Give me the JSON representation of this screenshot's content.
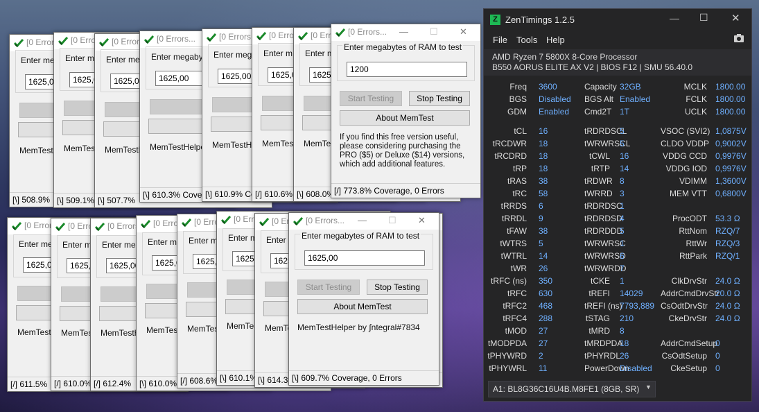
{
  "memtest": {
    "title": "[0 Errors...",
    "prompt": "Enter megabytes of RAM to test",
    "start_label": "Start Testing",
    "stop_label": "Stop Testing",
    "about_label": "About MemTest",
    "status_prefix": "[\\]",
    "win_top": [
      {
        "title": "[0 Errors",
        "prompt": "Enter meg",
        "value": "1625,00",
        "start": "Start Te",
        "about": "",
        "foot": "MemTestH",
        "status": "[\\]  508.9%"
      },
      {
        "title": "[0 Errors",
        "prompt": "Enter me",
        "value": "1625,00",
        "start": "Start Te",
        "about": "",
        "foot": "MemTestH",
        "status": "[\\]  509.1%"
      },
      {
        "title": "[0 Errors",
        "prompt": "Enter me",
        "value": "1625,00",
        "start": "Start Te",
        "about": "",
        "foot": "MemTestH",
        "status": "[\\]  507.7%"
      },
      {
        "title": "[0 Errors...",
        "prompt": "Enter megabytes",
        "value": "1625,00",
        "start": "Start Testing",
        "about": "Abou",
        "foot": "MemTestHelper",
        "status": "[\\]  610.3% Cover"
      },
      {
        "title": "[0 Errors...",
        "prompt": "Enter mega",
        "value": "1625,00",
        "start": "Start Test",
        "about": "A",
        "foot": "MemTestHelp",
        "status": "[\\]  610.9% Cove"
      },
      {
        "title": "[0 Errors",
        "prompt": "Enter m",
        "value": "1625,00",
        "start": "Start T",
        "about": "",
        "foot": "MemTes",
        "status": "[/]  610.6%"
      },
      {
        "title": "[0 Errors",
        "prompt": "Enter m",
        "value": "1625,00",
        "start": "Start T",
        "about": "",
        "foot": "MemTes",
        "status": "[\\]  608.0%"
      }
    ],
    "main_top": {
      "title": "[0 Errors...",
      "value": "1200",
      "info": "If you find this free version useful, please considering purchasing the PRO ($5) or Deluxe ($14) versions, which add additional features.",
      "status": "[/]  773.8% Coverage, 0 Errors"
    },
    "win_bottom": [
      {
        "title": "[0 Errors",
        "prompt": "Enter meg",
        "value": "1625,00",
        "start": "Start Te",
        "foot": "MemTestH",
        "status": "[/]  611.5%"
      },
      {
        "title": "[0 Errors",
        "prompt": "Enter me",
        "value": "1625,00",
        "start": "Start Te",
        "foot": "MemTestH",
        "status": "[/]  610.0%"
      },
      {
        "title": "[0 Errors",
        "prompt": "Enter me",
        "value": "1625,00",
        "start": "Start Te",
        "foot": "MemTestH",
        "status": "[/]  612.4%"
      },
      {
        "title": "[0 Errors",
        "prompt": "Enter me",
        "value": "1625,00",
        "start": "Start Te",
        "foot": "MemTestH",
        "status": "[\\]  610.0%"
      },
      {
        "title": "[0 Errors",
        "prompt": "Enter me",
        "value": "1625,00",
        "start": "Start Te",
        "foot": "MemTestH",
        "status": "[/]  608.6%"
      },
      {
        "title": "[0 Errors",
        "prompt": "Enter m",
        "value": "1625,00",
        "start": "Start T",
        "foot": "MemTest",
        "status": "[\\]  610.1%"
      },
      {
        "title": "[0 Errors",
        "prompt": "Enter m",
        "value": "1625,00",
        "start": "Start",
        "foot": "MemTes",
        "status": "[\\]  614.3%"
      }
    ],
    "main_bottom": {
      "title": "[0 Errors...",
      "value": "1625,00",
      "foot": "MemTestHelper by ∫ntegral#7834",
      "status": "[\\]  609.7% Coverage, 0 Errors"
    }
  },
  "zentimings": {
    "title": "ZenTimings 1.2.5",
    "menu": [
      "File",
      "Tools",
      "Help"
    ],
    "cpu": "AMD Ryzen 7 5800X 8-Core Processor",
    "board": "B550 AORUS ELITE AX V2 | BIOS F12 | SMU 56.40.0",
    "rows_top": [
      [
        "Freq",
        "3600",
        "Capacity",
        "32GB",
        "MCLK",
        "1800.00"
      ],
      [
        "BGS",
        "Disabled",
        "BGS Alt",
        "Enabled",
        "FCLK",
        "1800.00"
      ],
      [
        "GDM",
        "Enabled",
        "Cmd2T",
        "1T",
        "UCLK",
        "1800.00"
      ]
    ],
    "rows": [
      [
        "tCL",
        "16",
        "tRDRDSCL",
        "5",
        "VSOC (SVI2)",
        "1,0875V"
      ],
      [
        "tRCDWR",
        "18",
        "tWRWRSCL",
        "5",
        "CLDO VDDP",
        "0,9002V"
      ],
      [
        "tRCDRD",
        "18",
        "tCWL",
        "16",
        "VDDG CCD",
        "0,9976V"
      ],
      [
        "tRP",
        "18",
        "tRTP",
        "14",
        "VDDG IOD",
        "0,9976V"
      ],
      [
        "tRAS",
        "38",
        "tRDWR",
        "8",
        "VDIMM",
        "1,3600V"
      ],
      [
        "tRC",
        "58",
        "tWRRD",
        "3",
        "MEM VTT",
        "0,6800V"
      ],
      [
        "tRRDS",
        "6",
        "tRDRDSC",
        "1",
        "",
        ""
      ],
      [
        "tRRDL",
        "9",
        "tRDRDSD",
        "4",
        "ProcODT",
        "53.3 Ω"
      ],
      [
        "tFAW",
        "38",
        "tRDRDDD",
        "5",
        "RttNom",
        "RZQ/7"
      ],
      [
        "tWTRS",
        "5",
        "tWRWRSC",
        "1",
        "RttWr",
        "RZQ/3"
      ],
      [
        "tWTRL",
        "14",
        "tWRWRSD",
        "6",
        "RttPark",
        "RZQ/1"
      ],
      [
        "tWR",
        "26",
        "tWRWRDD",
        "7",
        "",
        ""
      ],
      [
        "tRFC (ns)",
        "350",
        "tCKE",
        "1",
        "ClkDrvStr",
        "24.0 Ω"
      ],
      [
        "tRFC",
        "630",
        "tREFI",
        "14029",
        "AddrCmdDrvStr",
        "20.0 Ω"
      ],
      [
        "tRFC2",
        "468",
        "tREFI (ns)",
        "7793,889",
        "CsOdtDrvStr",
        "24.0 Ω"
      ],
      [
        "tRFC4",
        "288",
        "tSTAG",
        "210",
        "CkeDrvStr",
        "24.0 Ω"
      ],
      [
        "tMOD",
        "27",
        "tMRD",
        "8",
        "",
        ""
      ],
      [
        "tMODPDA",
        "27",
        "tMRDPDA",
        "18",
        "AddrCmdSetup",
        "0"
      ],
      [
        "tPHYWRD",
        "2",
        "tPHYRDL",
        "26",
        "CsOdtSetup",
        "0"
      ],
      [
        "tPHYWRL",
        "11",
        "PowerDown",
        "Disabled",
        "CkeSetup",
        "0"
      ]
    ],
    "module": "A1: BL8G36C16U4B.M8FE1 (8GB, SR)",
    "colors": {
      "bg": "#252526",
      "value": "#6fb0ff",
      "logo": "#1db954"
    }
  }
}
